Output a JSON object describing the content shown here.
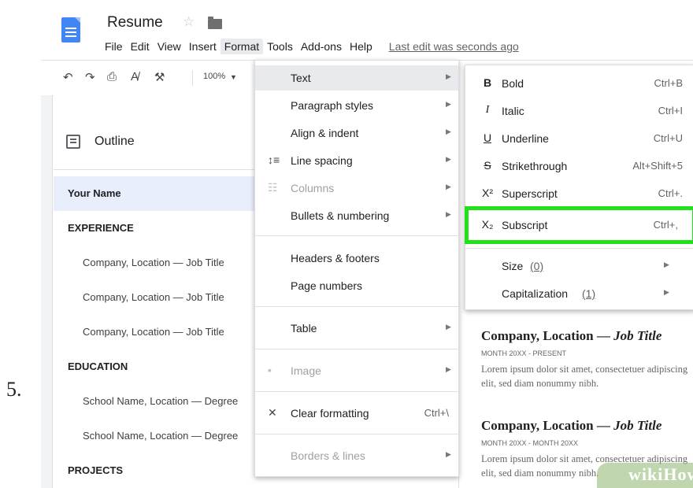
{
  "step_number": "5.",
  "title_bar": {
    "document_title": "Resume",
    "icons": [
      "docs-logo-icon",
      "star-icon",
      "folder-icon"
    ]
  },
  "menubar": {
    "items": [
      "File",
      "Edit",
      "View",
      "Insert",
      "Format",
      "Tools",
      "Add-ons",
      "Help"
    ],
    "active": "Format",
    "last_edit": "Last edit was seconds ago"
  },
  "toolbar": {
    "icons": [
      "undo-icon",
      "redo-icon",
      "print-icon",
      "spellcheck-icon",
      "paint-format-icon",
      "zoom-dropdown-arrow-icon"
    ],
    "zoom": "100%"
  },
  "outline": {
    "title": "Outline",
    "items": [
      {
        "label": "Your Name",
        "level": "h1",
        "selected": true
      },
      {
        "label": "EXPERIENCE",
        "level": "h1"
      },
      {
        "label": "Company, Location — Job Title",
        "level": "h2"
      },
      {
        "label": "Company, Location — Job Title",
        "level": "h2"
      },
      {
        "label": "Company, Location — Job Title",
        "level": "h2"
      },
      {
        "label": "EDUCATION",
        "level": "h1"
      },
      {
        "label": "School Name, Location — Degree",
        "level": "h2"
      },
      {
        "label": "School Name, Location — Degree",
        "level": "h2"
      },
      {
        "label": "PROJECTS",
        "level": "h1"
      }
    ]
  },
  "format_menu": {
    "items": [
      {
        "label": "Text",
        "submenu": true,
        "highlight": true
      },
      {
        "label": "Paragraph styles",
        "submenu": true
      },
      {
        "label": "Align & indent",
        "submenu": true
      },
      {
        "label": "Line spacing",
        "submenu": true,
        "icon": "line-spacing-icon"
      },
      {
        "label": "Columns",
        "submenu": true,
        "icon": "columns-icon",
        "disabled": true
      },
      {
        "label": "Bullets & numbering",
        "submenu": true
      },
      {
        "label": "Headers & footers"
      },
      {
        "label": "Page numbers"
      },
      {
        "label": "Table",
        "submenu": true
      },
      {
        "label": "Image",
        "submenu": true,
        "icon": "image-icon",
        "disabled": true
      },
      {
        "label": "Clear formatting",
        "shortcut": "Ctrl+\\",
        "icon": "clear-formatting-icon"
      },
      {
        "label": "Borders & lines",
        "submenu": true,
        "disabled": true
      }
    ]
  },
  "text_submenu": {
    "items": [
      {
        "icon_glyph": "B",
        "label": "Bold",
        "shortcut": "Ctrl+B"
      },
      {
        "icon_glyph": "I",
        "label": "Italic",
        "shortcut": "Ctrl+I"
      },
      {
        "icon_glyph": "U",
        "label": "Underline",
        "shortcut": "Ctrl+U"
      },
      {
        "icon_glyph": "S",
        "label": "Strikethrough",
        "shortcut": "Alt+Shift+5"
      },
      {
        "icon_glyph": "X²",
        "label": "Superscript",
        "shortcut": "Ctrl+."
      },
      {
        "icon_glyph": "X₂",
        "label": "Subscript",
        "shortcut": "Ctrl+,",
        "outlined": true
      },
      {
        "label": "Size",
        "count": "(0)",
        "submenu": true
      },
      {
        "label": "Capitalization",
        "count": "(1)",
        "submenu": true
      }
    ],
    "highlight_color": "#22e01a"
  },
  "document_body": {
    "entries": [
      {
        "company": "Company, Location — ",
        "job_title": "Job Title",
        "dates": "MONTH 20XX - PRESENT",
        "text": "Lorem ipsum dolor sit amet, consectetuer adipiscing elit, sed diam nonummy nibh."
      },
      {
        "company": "Company, Location — ",
        "job_title": "Job Title",
        "dates": "MONTH 20XX - MONTH 20XX",
        "text": "Lorem ipsum dolor sit amet, consectetuer adipiscing elit, sed diam nonummy nibh."
      }
    ]
  },
  "watermark": "wikiHow"
}
